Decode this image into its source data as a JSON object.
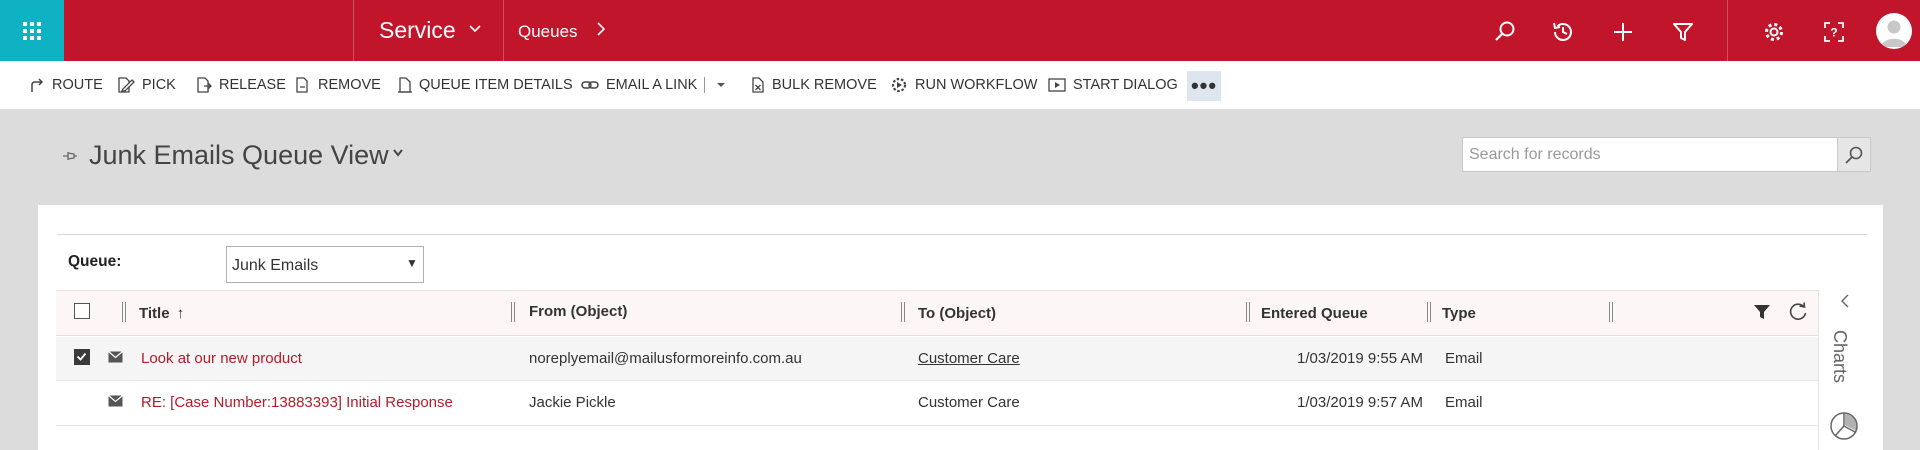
{
  "topbar": {
    "app_name": "Service",
    "area_name": "Queues",
    "icons": [
      "search-icon",
      "history-icon",
      "plus-icon",
      "filter-icon",
      "gear-icon",
      "help-icon",
      "avatar"
    ],
    "accent_color": "#c0152a",
    "waffle_color": "#0fb2c3"
  },
  "commands": {
    "route": "ROUTE",
    "pick": "PICK",
    "release": "RELEASE",
    "remove": "REMOVE",
    "queue_item_details": "QUEUE ITEM DETAILS",
    "email_a_link": "EMAIL A LINK",
    "bulk_remove": "BULK REMOVE",
    "run_workflow": "RUN WORKFLOW",
    "start_dialog": "START DIALOG",
    "more": "•••"
  },
  "view": {
    "title": "Junk Emails Queue View",
    "search_placeholder": "Search for records"
  },
  "filter": {
    "label": "Queue:",
    "selected": "Junk Emails"
  },
  "grid": {
    "columns": {
      "title": "Title",
      "title_sort": "↑",
      "from": "From (Object)",
      "to": "To (Object)",
      "entered": "Entered Queue",
      "type": "Type"
    },
    "rows": [
      {
        "selected": true,
        "title": "Look at our new product",
        "from": "noreplyemail@mailusformoreinfo.com.au",
        "to": "Customer Care",
        "entered": "1/03/2019 9:55 AM",
        "type": "Email"
      },
      {
        "selected": false,
        "title": "RE: [Case Number:13883393] Initial Response",
        "from": "Jackie Pickle",
        "to": "Customer Care",
        "entered": "1/03/2019 9:57 AM",
        "type": "Email"
      }
    ]
  },
  "charts_pane": {
    "label": "Charts"
  }
}
